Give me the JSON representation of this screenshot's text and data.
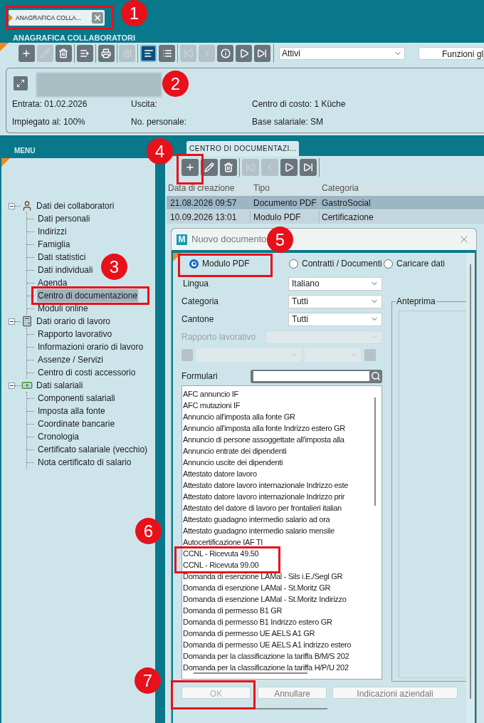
{
  "app_tab": {
    "label": "ANAGRAFICA COLLA..."
  },
  "section_title": "ANAGRAFICA COLLABORATORI",
  "toolbar": {
    "buttons": [
      {
        "kind": "add",
        "disabled": false,
        "selected": false
      },
      {
        "kind": "edit",
        "disabled": true,
        "selected": false
      },
      {
        "kind": "delete",
        "disabled": false,
        "selected": false
      },
      {
        "kind": "import",
        "disabled": false,
        "selected": false
      },
      {
        "kind": "print",
        "disabled": false,
        "selected": false
      },
      {
        "kind": "settings",
        "disabled": true,
        "selected": false
      },
      {
        "kind": "detail-view",
        "disabled": false,
        "selected": true
      },
      {
        "kind": "list-view",
        "disabled": false,
        "selected": false
      },
      {
        "kind": "first",
        "disabled": true,
        "selected": false
      },
      {
        "kind": "previous",
        "disabled": true,
        "selected": false
      },
      {
        "kind": "info",
        "disabled": false,
        "selected": false
      },
      {
        "kind": "next",
        "disabled": false,
        "selected": false
      },
      {
        "kind": "last",
        "disabled": false,
        "selected": false
      }
    ],
    "filter": {
      "value": "Attivi"
    },
    "functions_button": "Funzioni gl"
  },
  "employee_card": {
    "rows": [
      {
        "cells": [
          "Entrata: 01.02.2026",
          "Uscita:",
          "Centro di costo: 1 Küche"
        ]
      },
      {
        "cells": [
          "Impiegato al: 100%",
          "No. personale:",
          "Base salariale: SM"
        ]
      }
    ]
  },
  "menu": {
    "title": "MENU",
    "tree": [
      {
        "label": "Dati dei collaboratori",
        "kind": "person",
        "expanded": true,
        "children": [
          {
            "label": "Dati personali",
            "selected": false
          },
          {
            "label": "Indirizzi",
            "selected": false
          },
          {
            "label": "Famiglia",
            "selected": false
          },
          {
            "label": "Dati statistici",
            "selected": false
          },
          {
            "label": "Dati individuali",
            "selected": false
          },
          {
            "label": "Agenda",
            "selected": false
          },
          {
            "label": "Centro di documentazione",
            "selected": true
          },
          {
            "label": "Moduli online",
            "selected": false
          }
        ]
      },
      {
        "label": "Dati orario di lavoro",
        "kind": "time",
        "expanded": true,
        "children": [
          {
            "label": "Rapporto lavorativo",
            "selected": false
          },
          {
            "label": "Informazioni orario di lavoro",
            "selected": false
          },
          {
            "label": "Assenze / Servizi",
            "selected": false
          },
          {
            "label": "Centro di costi accessorio",
            "selected": false
          }
        ]
      },
      {
        "label": "Dati salariali",
        "kind": "salary",
        "expanded": true,
        "children": [
          {
            "label": "Componenti salariali",
            "selected": false
          },
          {
            "label": "Imposta alla fonte",
            "selected": false
          },
          {
            "label": "Coordinate bancarie",
            "selected": false
          },
          {
            "label": "Cronologia",
            "selected": false
          },
          {
            "label": "Certificato salariale (vecchio)",
            "selected": false
          },
          {
            "label": "Nota certificato di salario",
            "selected": false
          }
        ]
      }
    ]
  },
  "documents": {
    "tab": "CENTRO DI DOCUMENTAZI...",
    "toolbar": [
      {
        "kind": "add",
        "disabled": false
      },
      {
        "kind": "edit",
        "disabled": false
      },
      {
        "kind": "delete",
        "disabled": false
      },
      {
        "kind": "first",
        "disabled": true
      },
      {
        "kind": "previous",
        "disabled": true
      },
      {
        "kind": "next",
        "disabled": false
      },
      {
        "kind": "last",
        "disabled": false
      }
    ],
    "columns": [
      "Data di creazione",
      "Tipo",
      "Categoria"
    ],
    "rows": [
      {
        "cells": [
          "21.08.2026 09:57",
          "Documento PDF",
          "GastroSocial"
        ],
        "selected": true
      },
      {
        "cells": [
          "10.09.2026 13:01",
          "Modulo PDF",
          "Certificazione"
        ],
        "selected": false
      }
    ]
  },
  "dialog": {
    "app_icon": "M",
    "title": "Nuovo documento",
    "options": [
      {
        "label": "Modulo PDF",
        "selected": true
      },
      {
        "label": "Contratti / Documenti",
        "selected": false
      },
      {
        "label": "Caricare dati",
        "selected": false
      }
    ],
    "fields": [
      {
        "label": "Lingua",
        "value": "Italiano",
        "disabled": false
      },
      {
        "label": "Categoria",
        "value": "Tutti",
        "disabled": false
      },
      {
        "label": "Cantone",
        "value": "Tutti",
        "disabled": false
      },
      {
        "label": "Rapporto lavorativo",
        "disabled": true
      }
    ],
    "secondary_filter": {
      "disabled": true
    },
    "search": {
      "label": "Formulari"
    },
    "forms": [
      "AFC annuncio IF",
      "AFC mutazioni IF",
      "Annuncio all'imposta alla fonte GR",
      "Annuncio all'imposta alla fonte Indrizzo estero GR",
      "Annuncio di persone assoggettate all'imposta alla",
      "Annuncio entrate dei dipendenti",
      "Annuncio uscite dei dipendenti",
      "Attestato datore lavoro",
      "Attestato datore lavoro internazionale Indrizzo este",
      "Attestato datore lavoro internazionale Indrizzo prir",
      "Attestato del datore di lavoro per  frontalieri italian",
      "Attestato guadagno intermedio salario ad ora",
      "Attestato guadagno intermedio salario mensile",
      "Autocertificazione IAF TI",
      "CCNL - Ricevuta 49.50",
      "CCNL - Ricevuta 99.00",
      "Domanda di esenzione LAMal - Sils i.E./Segl GR",
      "Domanda di esenzione LAMal - St.Moritz  GR",
      "Domanda di esenzione LAMal - St.Moritz Indirizzo",
      "Domanda di permesso B1 GR",
      "Domanda di permesso B1 Indrizzo estero GR",
      "Domanda di permesso UE AELS A1 GR",
      "Domanda di permesso UE AELS A1 indrizzo estero",
      "Domanda per la classificazione la tariffa B/M/S 202",
      "Domanda per la classificazione la tariffa H/P/U 202"
    ],
    "preview": {
      "title": "Anteprima"
    },
    "buttons": [
      {
        "label": "OK",
        "disabled": true
      },
      {
        "label": "Annullare",
        "disabled": false
      },
      {
        "label": "Indicazioni aziendali",
        "disabled": false
      }
    ]
  },
  "annotations": [
    {
      "label": "1",
      "boxed": true
    },
    {
      "label": "2",
      "boxed": false
    },
    {
      "label": "3",
      "boxed": true
    },
    {
      "label": "4",
      "boxed": true
    },
    {
      "label": "5",
      "boxed": true
    },
    {
      "label": "6",
      "boxed": true
    },
    {
      "label": "7",
      "boxed": true
    }
  ]
}
